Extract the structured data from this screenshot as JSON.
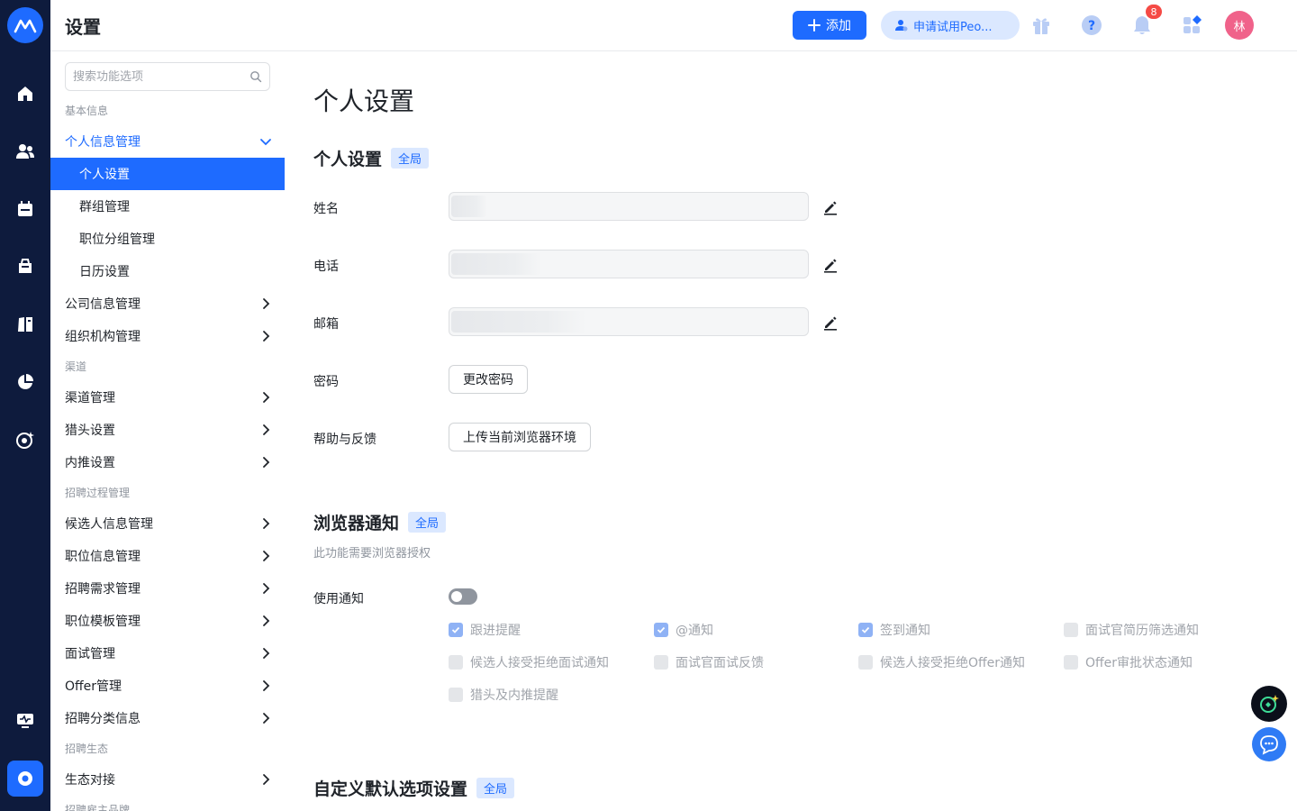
{
  "header": {
    "title": "设置",
    "add_label": "添加",
    "trial_label": "申请试用Peo...",
    "notification_count": "8",
    "avatar_text": "林"
  },
  "sidebar": {
    "search_placeholder": "搜索功能选项",
    "groups": {
      "basic": "基本信息",
      "channel": "渠道",
      "process": "招聘过程管理",
      "ecosystem": "招聘生态",
      "employer": "招聘雇主品牌"
    },
    "items": {
      "personal_info": "个人信息管理",
      "personal_settings": "个人设置",
      "group_mgmt": "群组管理",
      "position_group_mgmt": "职位分组管理",
      "calendar_settings": "日历设置",
      "company_info": "公司信息管理",
      "org_mgmt": "组织机构管理",
      "channel_mgmt": "渠道管理",
      "headhunter_settings": "猎头设置",
      "referral_settings": "内推设置",
      "candidate_info": "候选人信息管理",
      "position_info": "职位信息管理",
      "demand_mgmt": "招聘需求管理",
      "template_mgmt": "职位模板管理",
      "interview_mgmt": "面试管理",
      "offer_mgmt": "Offer管理",
      "category_info": "招聘分类信息",
      "ecosystem_link": "生态对接"
    }
  },
  "main": {
    "page_title": "个人设置",
    "personal": {
      "title": "个人设置",
      "tag": "全局",
      "name_label": "姓名",
      "phone_label": "电话",
      "email_label": "邮箱",
      "password_label": "密码",
      "change_password": "更改密码",
      "help_label": "帮助与反馈",
      "upload_env": "上传当前浏览器环境"
    },
    "browser": {
      "title": "浏览器通知",
      "tag": "全局",
      "note": "此功能需要浏览器授权",
      "use_label": "使用通知",
      "enabled": false,
      "options": [
        {
          "label": "跟进提醒",
          "checked": true
        },
        {
          "label": "@通知",
          "checked": true
        },
        {
          "label": "签到通知",
          "checked": true
        },
        {
          "label": "面试官简历筛选通知",
          "checked": false
        },
        {
          "label": "候选人接受拒绝面试通知",
          "checked": false
        },
        {
          "label": "面试官面试反馈",
          "checked": false
        },
        {
          "label": "候选人接受拒绝Offer通知",
          "checked": false
        },
        {
          "label": "Offer审批状态通知",
          "checked": false
        },
        {
          "label": "猎头及内推提醒",
          "checked": false
        }
      ]
    },
    "defaults": {
      "title": "自定义默认选项设置",
      "tag": "全局"
    }
  },
  "colors": {
    "primary": "#1e6bff",
    "rail": "#0e1b3d",
    "badge": "#f54a45",
    "avatar": "#f0628a"
  }
}
